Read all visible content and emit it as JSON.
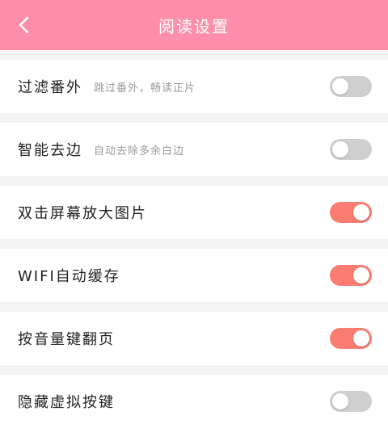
{
  "header": {
    "title": "阅读设置",
    "bg_color": "#ff8fa8",
    "back_icon": "chevron-left-icon"
  },
  "settings": [
    {
      "label": "过滤番外",
      "desc": "跳过番外，畅读正片",
      "on": false
    },
    {
      "label": "智能去边",
      "desc": "自动去除多余白边",
      "on": false
    },
    {
      "label": "双击屏幕放大图片",
      "desc": "",
      "on": true
    },
    {
      "label": "WIFI自动缓存",
      "desc": "",
      "on": true
    },
    {
      "label": "按音量键翻页",
      "desc": "",
      "on": true
    },
    {
      "label": "隐藏虚拟按键",
      "desc": "",
      "on": false
    }
  ],
  "colors": {
    "toggle_on": "#fb7c70",
    "toggle_off": "#cfcfcf"
  }
}
